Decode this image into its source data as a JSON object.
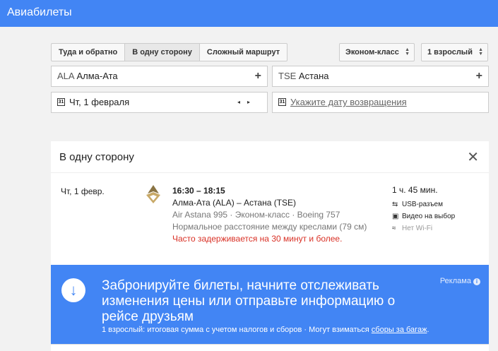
{
  "header": {
    "title": "Авиабилеты"
  },
  "trip_types": [
    "Туда и обратно",
    "В одну сторону",
    "Сложный маршрут"
  ],
  "cabin": {
    "value": "Эконом-класс"
  },
  "passengers": {
    "value": "1 взрослый"
  },
  "origin": {
    "code": "ALA",
    "city": "Алма-Ата",
    "add": "+"
  },
  "destination": {
    "code": "TSE",
    "city": "Астана",
    "add": "+"
  },
  "depart": {
    "cal_day": "31",
    "value": "Чт, 1 февраля",
    "prev": "◂",
    "next": "▸"
  },
  "return": {
    "cal_day": "31",
    "placeholder": "Укажите дату возвращения"
  },
  "results": {
    "title": "В одну сторону",
    "close": "✕",
    "flight": {
      "date": "Чт, 1 февр.",
      "times": "16:30 – 18:15",
      "route": "Алма-Ата (ALA) – Астана (TSE)",
      "details": "Air Astana 995 · Эконом-класс · Boeing 757",
      "seat": "Нормальное расстояние между креслами (79 см)",
      "delay": "Часто задерживается на 30 минут и более.",
      "duration": "1 ч. 45 мин.",
      "amenities": [
        "USB-разъем",
        "Видео на выбор",
        "Нет Wi-Fi"
      ]
    }
  },
  "ad": {
    "headline": "Забронируйте билеты, начните отслеживать изменения цены или отправьте информацию о рейсе друзьям",
    "label": "Реклама",
    "footer_text": "1 взрослый: итоговая сумма с учетом налогов и сборов · Могут взиматься ",
    "footer_link": "сборы за багаж",
    "footer_end": "."
  },
  "colors": {
    "brand": "#4285f4",
    "warning": "#d93025"
  }
}
